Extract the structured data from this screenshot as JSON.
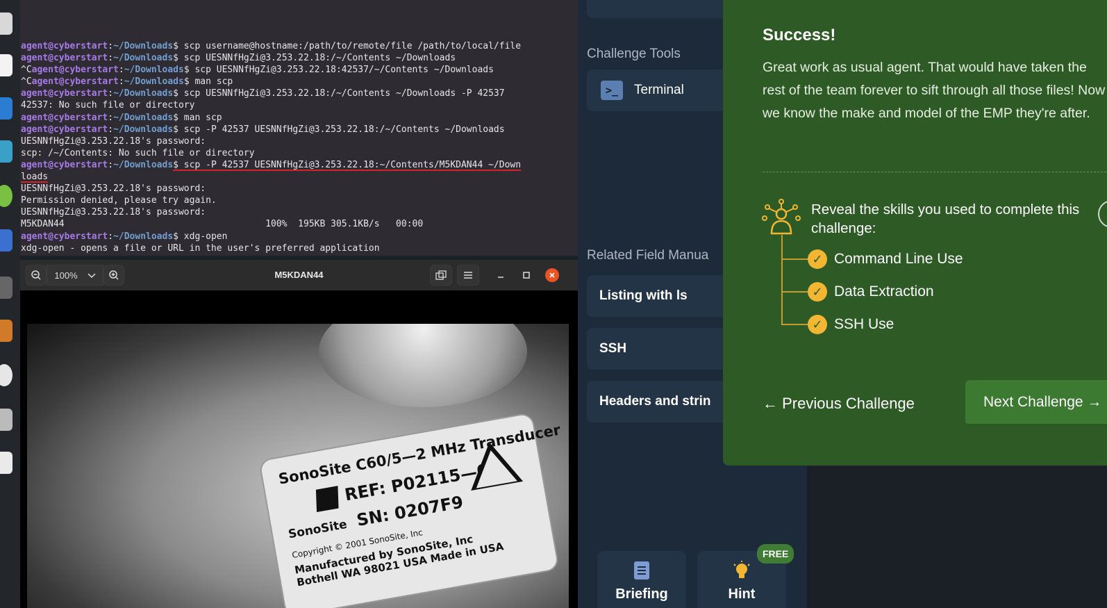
{
  "terminal": {
    "lines": [
      {
        "prompt_user": "agent@cyberstart",
        "prompt_path": "~/Downloads",
        "cmd": "$ scp username@hostname:/path/to/remote/file /path/to/local/file"
      },
      {
        "prompt_user": "agent@cyberstart",
        "prompt_path": "~/Downloads",
        "cmd": "$ scp UESNNfHgZi@3.253.22.18:/~/Contents ~/Downloads"
      },
      {
        "pre": "^C",
        "prompt_user": "agent@cyberstart",
        "prompt_path": "~/Downloads",
        "cmd": "$ scp UESNNfHgZi@3.253.22.18:42537/~/Contents ~/Downloads"
      },
      {
        "pre": "^C",
        "prompt_user": "agent@cyberstart",
        "prompt_path": "~/Downloads",
        "cmd": "$ man scp"
      },
      {
        "prompt_user": "agent@cyberstart",
        "prompt_path": "~/Downloads",
        "cmd": "$ scp UESNNfHgZi@3.253.22.18:/~/Contents ~/Downloads -P 42537"
      },
      {
        "text": "42537: No such file or directory"
      },
      {
        "prompt_user": "agent@cyberstart",
        "prompt_path": "~/Downloads",
        "cmd": "$ man scp"
      },
      {
        "prompt_user": "agent@cyberstart",
        "prompt_path": "~/Downloads",
        "cmd": "$ scp -P 42537 UESNNfHgZi@3.253.22.18:/~/Contents ~/Downloads"
      },
      {
        "text": "UESNNfHgZi@3.253.22.18's password:"
      },
      {
        "text": "scp: /~/Contents: No such file or directory"
      },
      {
        "prompt_user": "agent@cyberstart",
        "prompt_path": "~/Downloads",
        "cmd": "$ scp -P 42537 UESNNfHgZi@3.253.22.18:~/Contents/M5KDAN44 ~/Down",
        "underline": true
      },
      {
        "text": "loads",
        "underline": true
      },
      {
        "text": "UESNNfHgZi@3.253.22.18's password:"
      },
      {
        "text": "Permission denied, please try again."
      },
      {
        "text": "UESNNfHgZi@3.253.22.18's password:"
      },
      {
        "text": "M5KDAN44                                     100%  195KB 305.1KB/s   00:00"
      },
      {
        "prompt_user": "agent@cyberstart",
        "prompt_path": "~/Downloads",
        "cmd": "$ xdg-open"
      },
      {
        "text": "xdg-open - opens a file or URL in the user's preferred application"
      }
    ]
  },
  "viewer": {
    "zoom": "100%",
    "title": "M5KDAN44",
    "zoom_out_icon": "zoom-out-icon",
    "zoom_in_icon": "zoom-in-icon",
    "photo": {
      "line1": "SonoSite C60/5—2 MHz Transducer",
      "line2": "REF: P02115—03",
      "line3_brand": "SonoSite",
      "line3_sn": "SN: 0207F9",
      "line4": "Copyright © 2001 SonoSite, Inc",
      "line5": "Manufactured by SonoSite, Inc",
      "line6": "Bothell WA 98021 USA   Made in USA"
    }
  },
  "sidebar": {
    "tools_heading": "Challenge Tools",
    "terminal_label": "Terminal",
    "manuals_heading": "Related Field Manua",
    "manuals": [
      "Listing with ls",
      "SSH",
      "Headers and strin"
    ],
    "briefing_label": "Briefing",
    "hint_label": "Hint",
    "free_badge": "FREE"
  },
  "success": {
    "title": "Success!",
    "body": "Great work as usual agent. That would have taken the rest of the team forever to sift through all those files! Now we know the make and model of the EMP they're after.",
    "skills_heading": "Reveal the skills you used to complete this challenge:",
    "skills": [
      "Command Line Use",
      "Data Extraction",
      "SSH Use"
    ],
    "prev_label": "← Previous Challenge",
    "next_label": "Next Challenge →"
  },
  "colors": {
    "success_green": "#2e5a25",
    "skill_gold": "#f2b632",
    "sidebar_bg": "#1c2a3a",
    "terminal_bg": "#2f2b33"
  }
}
